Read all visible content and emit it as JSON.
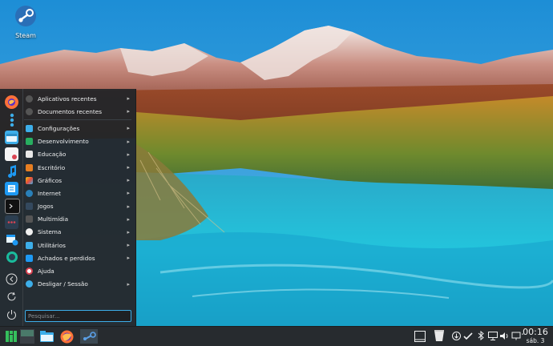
{
  "desktop": {
    "icons": [
      {
        "label": "Steam",
        "icon": "steam-icon"
      }
    ]
  },
  "launcher": {
    "favorites": [
      {
        "icon": "firefox-icon"
      },
      {
        "icon": "settings-icon"
      },
      {
        "icon": "file-manager-icon"
      },
      {
        "icon": "document-viewer-icon"
      },
      {
        "icon": "music-player-icon"
      },
      {
        "icon": "text-editor-icon"
      },
      {
        "icon": "terminal-icon"
      },
      {
        "icon": "discover-icon"
      },
      {
        "icon": "package-icon"
      },
      {
        "icon": "circle-app-icon"
      }
    ],
    "session_actions": [
      {
        "icon": "back-icon"
      },
      {
        "icon": "restart-icon"
      },
      {
        "icon": "shutdown-icon"
      }
    ],
    "recent": [
      {
        "label": "Aplicativos recentes",
        "icon": "recent-apps-icon"
      },
      {
        "label": "Documentos recentes",
        "icon": "recent-docs-icon"
      }
    ],
    "categories": [
      {
        "label": "Configurações",
        "icon": "settings-category-icon",
        "color": "#3daee9"
      },
      {
        "label": "Desenvolvimento",
        "icon": "development-icon",
        "color": "#27ae60"
      },
      {
        "label": "Educação",
        "icon": "education-icon",
        "color": "#e8e8e8"
      },
      {
        "label": "Escritório",
        "icon": "office-icon",
        "color": "#e67e22"
      },
      {
        "label": "Gráficos",
        "icon": "graphics-icon",
        "color": "#f1c40f"
      },
      {
        "label": "Internet",
        "icon": "internet-icon",
        "color": "#2980b9"
      },
      {
        "label": "Jogos",
        "icon": "games-icon",
        "color": "#34495e"
      },
      {
        "label": "Multimídia",
        "icon": "multimedia-icon",
        "color": "#555"
      },
      {
        "label": "Sistema",
        "icon": "system-icon",
        "color": "#f0f0f0"
      },
      {
        "label": "Utilitários",
        "icon": "utilities-icon",
        "color": "#3daee9"
      },
      {
        "label": "Achados e perdidos",
        "icon": "lost-found-icon",
        "color": "#1d99f3"
      }
    ],
    "help": {
      "label": "Ajuda",
      "icon": "help-icon",
      "color": "#da4453"
    },
    "logout": {
      "label": "Desligar / Sessão",
      "icon": "leave-icon"
    },
    "search_placeholder": "Pesquisar..."
  },
  "taskbar": {
    "items": [
      {
        "icon": "app-menu-icon"
      },
      {
        "icon": "virtual-desktop-icon"
      },
      {
        "icon": "file-manager-icon"
      },
      {
        "icon": "firefox-icon"
      },
      {
        "icon": "steam-icon"
      }
    ],
    "tray": [
      {
        "icon": "show-desktop-icon"
      },
      {
        "icon": "trash-icon"
      },
      {
        "icon": "updates-icon"
      },
      {
        "icon": "steam-tray-icon"
      },
      {
        "icon": "bluetooth-icon"
      },
      {
        "icon": "display-icon"
      },
      {
        "icon": "volume-icon"
      },
      {
        "icon": "network-icon"
      },
      {
        "icon": "expand-tray-icon"
      }
    ],
    "clock": {
      "time": "00:16",
      "date": "sáb. 3"
    }
  }
}
